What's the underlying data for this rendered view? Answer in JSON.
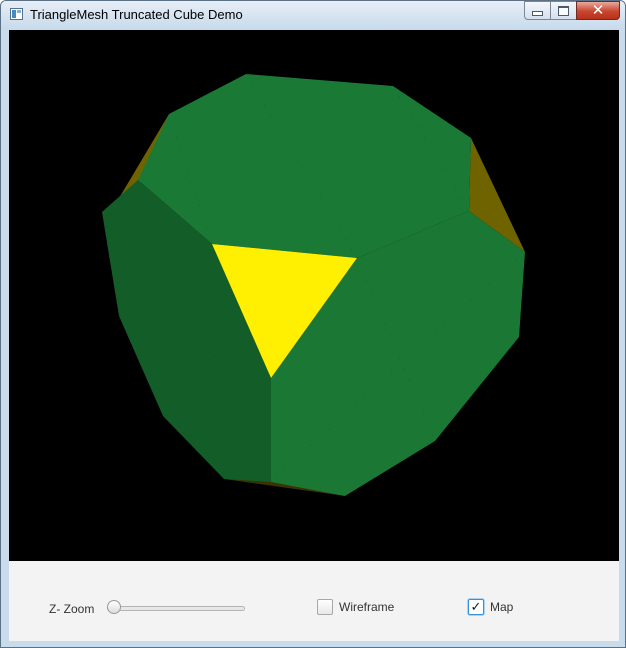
{
  "window": {
    "title": "TriangleMesh Truncated Cube Demo",
    "app_icon": "java-window-icon",
    "buttons": {
      "minimize": "minimize-icon",
      "maximize": "maximize-icon",
      "close": "close-icon",
      "close_glyph": "✕"
    }
  },
  "scene": {
    "background": "#000000",
    "object": "truncated-cube",
    "colors": {
      "top_face": "#1a7a35",
      "left_face": "#135d29",
      "right_face": "#1a7834",
      "triangle_face": "#ffef00",
      "side_triangles": "#6f6300"
    }
  },
  "controls": {
    "zoom_label": "Z- Zoom",
    "zoom_value": 0,
    "wireframe_label": "Wireframe",
    "wireframe_checked": false,
    "map_label": "Map",
    "map_checked": true,
    "check_glyph": "✓"
  }
}
